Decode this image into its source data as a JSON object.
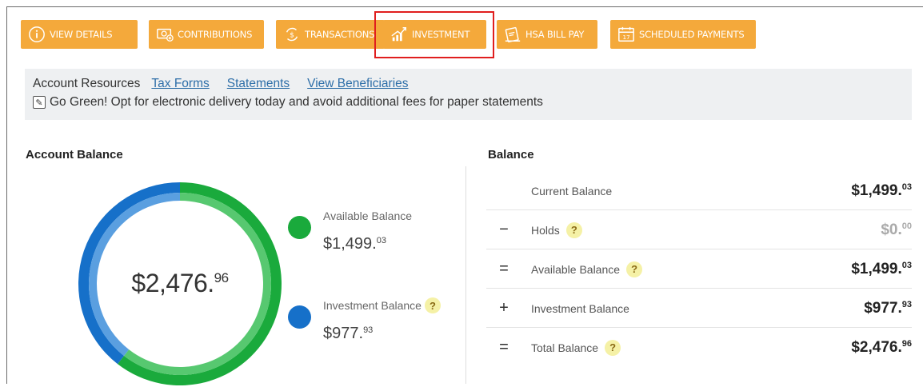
{
  "toolbar": {
    "buttons": [
      {
        "label": "VIEW DETAILS",
        "icon": "info-icon"
      },
      {
        "label": "CONTRIBUTIONS",
        "icon": "money-plus-icon"
      },
      {
        "label": "TRANSACTIONS",
        "icon": "dollar-arrows-icon"
      },
      {
        "label": "INVESTMENT",
        "icon": "growth-chart-icon"
      },
      {
        "label": "HSA BILL PAY",
        "icon": "bill-pay-icon"
      },
      {
        "label": "SCHEDULED PAYMENTS",
        "icon": "calendar-icon"
      }
    ],
    "calendar_day": "17",
    "accent_color": "#f4a93b",
    "highlight_color": "#e01e1e"
  },
  "resources": {
    "label": "Account Resources",
    "links": [
      "Tax Forms",
      "Statements",
      "View Beneficiaries"
    ],
    "notice": "Go Green! Opt for electronic delivery today and avoid additional fees for paper statements"
  },
  "account_balance": {
    "title": "Account Balance",
    "total_main": "$2,476.",
    "total_cents": "96",
    "legend": [
      {
        "label": "Available Balance",
        "main": "$1,499.",
        "cents": "03",
        "color": "#1aaa3c",
        "value": 1499.03
      },
      {
        "label": "Investment Balance",
        "main": "$977.",
        "cents": "93",
        "color": "#1670c9",
        "value": 977.93
      }
    ]
  },
  "balance": {
    "title": "Balance",
    "rows": [
      {
        "op": "",
        "name": "Current Balance",
        "help": false,
        "main": "$1,499.",
        "cents": "03",
        "muted": false
      },
      {
        "op": "−",
        "name": "Holds",
        "help": true,
        "main": "$0.",
        "cents": "00",
        "muted": true
      },
      {
        "op": "=",
        "name": "Available Balance",
        "help": true,
        "main": "$1,499.",
        "cents": "03",
        "muted": false
      },
      {
        "op": "+",
        "name": "Investment Balance",
        "help": false,
        "main": "$977.",
        "cents": "93",
        "muted": false
      },
      {
        "op": "=",
        "name": "Total Balance",
        "help": true,
        "main": "$2,476.",
        "cents": "96",
        "muted": false
      }
    ],
    "help_symbol": "?"
  }
}
